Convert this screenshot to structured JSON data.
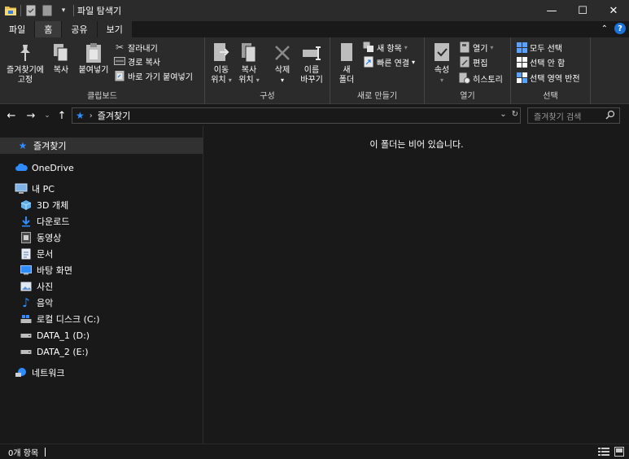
{
  "window": {
    "title": "파일 탐색기",
    "controls": {
      "minimize": "—",
      "maximize": "☐",
      "close": "✕"
    }
  },
  "tabs": [
    {
      "label": "파일"
    },
    {
      "label": "홈"
    },
    {
      "label": "공유"
    },
    {
      "label": "보기"
    }
  ],
  "ribbon": {
    "clipboard": {
      "label": "클립보드",
      "pin_label_1": "즐겨찾기에",
      "pin_label_2": "고정",
      "copy_label": "복사",
      "paste_label": "붙여넣기",
      "cut_label": "잘라내기",
      "copy_path_label": "경로 복사",
      "paste_shortcut_label": "바로 가기 붙여넣기"
    },
    "organize": {
      "label": "구성",
      "move_label_1": "이동",
      "move_label_2": "위치",
      "copyto_label_1": "복사",
      "copyto_label_2": "위치",
      "delete_label": "삭제",
      "rename_label_1": "이름",
      "rename_label_2": "바꾸기"
    },
    "new": {
      "label": "새로 만들기",
      "new_folder_label_1": "새",
      "new_folder_label_2": "폴더",
      "new_item_label": "새 항목",
      "easy_access_label": "빠른 연결"
    },
    "open": {
      "label": "열기",
      "properties_label": "속성",
      "open_label": "열기",
      "edit_label": "편집",
      "history_label": "히스토리"
    },
    "select": {
      "label": "선택",
      "select_all_label": "모두 선택",
      "select_none_label": "선택 안 함",
      "invert_label": "선택 영역 반전"
    }
  },
  "address": {
    "location": "즐겨찾기",
    "search_placeholder": "즐겨찾기 검색"
  },
  "nav": {
    "quick_access": "즐겨찾기",
    "onedrive": "OneDrive",
    "this_pc": "내 PC",
    "items": [
      {
        "label": "3D 개체",
        "icon": "3d-objects-icon"
      },
      {
        "label": "다운로드",
        "icon": "downloads-icon"
      },
      {
        "label": "동영상",
        "icon": "videos-icon"
      },
      {
        "label": "문서",
        "icon": "documents-icon"
      },
      {
        "label": "바탕 화면",
        "icon": "desktop-icon"
      },
      {
        "label": "사진",
        "icon": "pictures-icon"
      },
      {
        "label": "음악",
        "icon": "music-icon"
      },
      {
        "label": "로컬 디스크 (C:)",
        "icon": "local-disk-icon"
      },
      {
        "label": "DATA_1 (D:)",
        "icon": "drive-icon"
      },
      {
        "label": "DATA_2 (E:)",
        "icon": "drive-icon"
      }
    ],
    "network": "네트워크"
  },
  "content": {
    "empty_message": "이 폴더는 비어 있습니다."
  },
  "status": {
    "item_count": "0개 항목"
  },
  "colors": {
    "background": "#191919",
    "ribbon": "#2b2b2b",
    "accent_blue": "#1a73d9",
    "selected": "#313131"
  }
}
